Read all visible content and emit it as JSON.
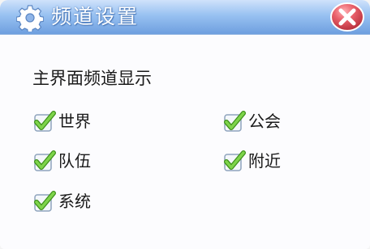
{
  "window": {
    "title": "频道设置"
  },
  "section": {
    "label": "主界面频道显示"
  },
  "options": [
    {
      "label": "世界",
      "checked": true
    },
    {
      "label": "公会",
      "checked": true
    },
    {
      "label": "队伍",
      "checked": true
    },
    {
      "label": "附近",
      "checked": true
    },
    {
      "label": "系统",
      "checked": true
    }
  ],
  "colors": {
    "title_bar": "#98c1f1",
    "close_button": "#e0505a",
    "checkmark": "#6cc43a"
  }
}
